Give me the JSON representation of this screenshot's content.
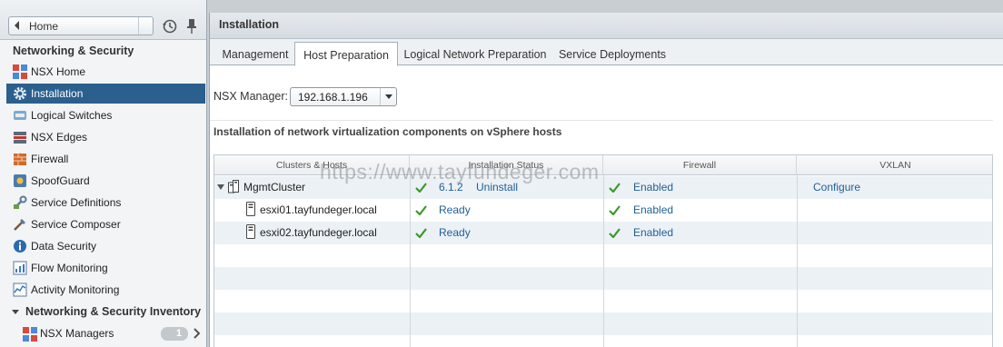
{
  "navigator": {
    "home_label": "Home",
    "section_title": "Networking & Security",
    "items": [
      {
        "label": "NSX Home",
        "icon": "nsx-home-icon"
      },
      {
        "label": "Installation",
        "icon": "gear-icon",
        "active": true
      },
      {
        "label": "Logical Switches",
        "icon": "logical-switch-icon"
      },
      {
        "label": "NSX Edges",
        "icon": "edge-icon"
      },
      {
        "label": "Firewall",
        "icon": "firewall-icon"
      },
      {
        "label": "SpoofGuard",
        "icon": "spoofguard-icon"
      },
      {
        "label": "Service Definitions",
        "icon": "service-definitions-icon"
      },
      {
        "label": "Service Composer",
        "icon": "service-composer-icon"
      },
      {
        "label": "Data Security",
        "icon": "data-security-icon"
      },
      {
        "label": "Flow Monitoring",
        "icon": "flow-monitoring-icon"
      },
      {
        "label": "Activity Monitoring",
        "icon": "activity-monitoring-icon"
      }
    ],
    "inventory_title": "Networking & Security Inventory",
    "inventory_items": [
      {
        "label": "NSX Managers",
        "count": "1",
        "icon": "nsx-managers-icon"
      }
    ]
  },
  "main": {
    "title": "Installation",
    "tabs": [
      {
        "label": "Management"
      },
      {
        "label": "Host Preparation",
        "active": true
      },
      {
        "label": "Logical Network Preparation"
      },
      {
        "label": "Service Deployments"
      }
    ],
    "nsx_manager_label": "NSX Manager:",
    "nsx_manager_value": "192.168.1.196",
    "section_title": "Installation of network virtualization components on vSphere hosts",
    "grid": {
      "headers": [
        "Clusters & Hosts",
        "Installation Status",
        "Firewall",
        "VXLAN"
      ],
      "rows": [
        {
          "name": "MgmtCluster",
          "kind": "cluster",
          "status_version": "6.1.2",
          "status_action": "Uninstall",
          "firewall": "Enabled",
          "vxlan": "Configure"
        },
        {
          "name": "esxi01.tayfundeger.local",
          "kind": "host",
          "status": "Ready",
          "firewall": "Enabled",
          "vxlan": ""
        },
        {
          "name": "esxi02.tayfundeger.local",
          "kind": "host",
          "status": "Ready",
          "firewall": "Enabled",
          "vxlan": ""
        }
      ]
    },
    "watermark": "https://www.tayfundeger.com"
  },
  "colors": {
    "nav_active": "#2b5f8e",
    "link": "#1f5f96",
    "check": "#3a9a2a"
  }
}
